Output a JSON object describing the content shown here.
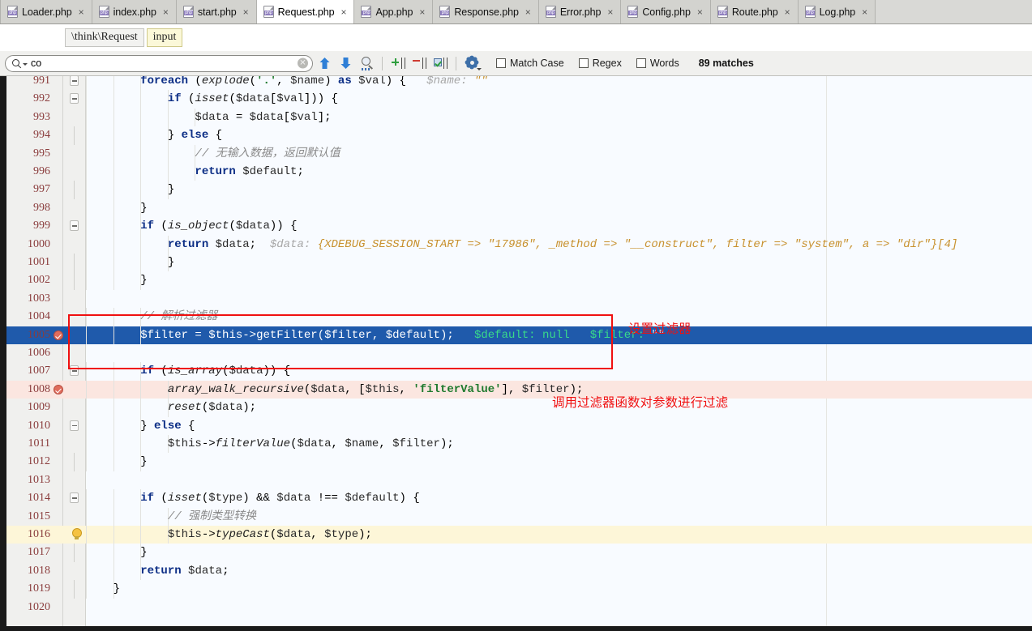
{
  "window": {
    "accent_selection": "#1f5aab",
    "annotation_color": "#f01010"
  },
  "tabs": [
    {
      "label": "Loader.php",
      "active": false,
      "close": "×",
      "icon": "php-file-icon"
    },
    {
      "label": "index.php",
      "active": false,
      "close": "×",
      "icon": "php-file-icon"
    },
    {
      "label": "start.php",
      "active": false,
      "close": "×",
      "icon": "php-file-icon"
    },
    {
      "label": "Request.php",
      "active": true,
      "close": "×",
      "icon": "php-file-icon"
    },
    {
      "label": "App.php",
      "active": false,
      "close": "×",
      "icon": "php-file-icon"
    },
    {
      "label": "Response.php",
      "active": false,
      "close": "×",
      "icon": "php-file-icon"
    },
    {
      "label": "Error.php",
      "active": false,
      "close": "×",
      "icon": "php-file-icon"
    },
    {
      "label": "Config.php",
      "active": false,
      "close": "×",
      "icon": "php-file-icon"
    },
    {
      "label": "Route.php",
      "active": false,
      "close": "×",
      "icon": "php-file-icon"
    },
    {
      "label": "Log.php",
      "active": false,
      "close": "×",
      "icon": "php-file-icon"
    }
  ],
  "breadcrumb": {
    "class": "\\think\\Request",
    "member": "input"
  },
  "search": {
    "query": "co",
    "clear_glyph": "✕",
    "match_case_label": "Match Case",
    "regex_label": "Regex",
    "words_label": "Words",
    "match_case_checked": false,
    "regex_checked": false,
    "words_checked": false,
    "result_count": "89 matches",
    "buttons": [
      {
        "name": "find-previous",
        "icon": "arrow-up-icon"
      },
      {
        "name": "find-next",
        "icon": "arrow-down-icon"
      },
      {
        "name": "find-all",
        "icon": "magnifier-list-icon"
      },
      {
        "name": "add-selection-next",
        "icon": "add-selection-icon"
      },
      {
        "name": "remove-selection",
        "icon": "remove-selection-icon"
      },
      {
        "name": "select-all-occurrences",
        "icon": "select-all-icon"
      },
      {
        "name": "search-settings",
        "icon": "gear-icon"
      }
    ]
  },
  "annotations": [
    {
      "id": "set-filter",
      "text": "设置过滤器"
    },
    {
      "id": "apply-filter",
      "text": "调用过滤器函数对参数进行过滤"
    }
  ],
  "editor": {
    "first_visible_line": 991,
    "lines": [
      {
        "n": 991,
        "fold": "collapse",
        "indent": 3,
        "state": "",
        "segments": [
          {
            "t": "        ",
            "c": "pm"
          },
          {
            "t": "foreach",
            "c": "kw"
          },
          {
            "t": " (",
            "c": "pm"
          },
          {
            "t": "explode",
            "c": "fn"
          },
          {
            "t": "(",
            "c": "pm"
          },
          {
            "t": "'.'",
            "c": "str"
          },
          {
            "t": ", ",
            "c": "pm"
          },
          {
            "t": "$name",
            "c": "var"
          },
          {
            "t": ") ",
            "c": "pm"
          },
          {
            "t": "as",
            "c": "kw"
          },
          {
            "t": " ",
            "c": "pm"
          },
          {
            "t": "$val",
            "c": "var"
          },
          {
            "t": ") {",
            "c": "pm"
          },
          {
            "t": "   $name: ",
            "c": "hint"
          },
          {
            "t": "\"\"",
            "c": "hintv"
          }
        ]
      },
      {
        "n": 992,
        "fold": "collapse",
        "indent": 4,
        "state": "",
        "segments": [
          {
            "t": "            ",
            "c": "pm"
          },
          {
            "t": "if",
            "c": "kw"
          },
          {
            "t": " (",
            "c": "pm"
          },
          {
            "t": "isset",
            "c": "fn"
          },
          {
            "t": "(",
            "c": "pm"
          },
          {
            "t": "$data",
            "c": "var"
          },
          {
            "t": "[",
            "c": "pm"
          },
          {
            "t": "$val",
            "c": "var"
          },
          {
            "t": "])) {",
            "c": "pm"
          }
        ]
      },
      {
        "n": 993,
        "fold": "",
        "indent": 5,
        "state": "",
        "segments": [
          {
            "t": "                ",
            "c": "pm"
          },
          {
            "t": "$data",
            "c": "var"
          },
          {
            "t": " = ",
            "c": "pm"
          },
          {
            "t": "$data",
            "c": "var"
          },
          {
            "t": "[",
            "c": "pm"
          },
          {
            "t": "$val",
            "c": "var"
          },
          {
            "t": "];",
            "c": "pm"
          }
        ]
      },
      {
        "n": 994,
        "fold": "end",
        "indent": 4,
        "state": "",
        "segments": [
          {
            "t": "            } ",
            "c": "pm"
          },
          {
            "t": "else",
            "c": "kw"
          },
          {
            "t": " {",
            "c": "pm"
          }
        ]
      },
      {
        "n": 995,
        "fold": "",
        "indent": 5,
        "state": "",
        "segments": [
          {
            "t": "                ",
            "c": "pm"
          },
          {
            "t": "// 无输入数据，返回默认值",
            "c": "cmt"
          }
        ]
      },
      {
        "n": 996,
        "fold": "",
        "indent": 5,
        "state": "",
        "segments": [
          {
            "t": "                ",
            "c": "pm"
          },
          {
            "t": "return",
            "c": "kw"
          },
          {
            "t": " ",
            "c": "pm"
          },
          {
            "t": "$default",
            "c": "var"
          },
          {
            "t": ";",
            "c": "pm"
          }
        ]
      },
      {
        "n": 997,
        "fold": "end",
        "indent": 4,
        "state": "",
        "segments": [
          {
            "t": "            }",
            "c": "pm"
          }
        ]
      },
      {
        "n": 998,
        "fold": "",
        "indent": 3,
        "state": "",
        "segments": [
          {
            "t": "        }",
            "c": "pm"
          }
        ]
      },
      {
        "n": 999,
        "fold": "collapse",
        "indent": 3,
        "state": "",
        "segments": [
          {
            "t": "        ",
            "c": "pm"
          },
          {
            "t": "if",
            "c": "kw"
          },
          {
            "t": " (",
            "c": "pm"
          },
          {
            "t": "is_object",
            "c": "fn"
          },
          {
            "t": "(",
            "c": "pm"
          },
          {
            "t": "$data",
            "c": "var"
          },
          {
            "t": ")) {",
            "c": "pm"
          }
        ]
      },
      {
        "n": 1000,
        "fold": "",
        "indent": 4,
        "state": "",
        "segments": [
          {
            "t": "            ",
            "c": "pm"
          },
          {
            "t": "return",
            "c": "kw"
          },
          {
            "t": " ",
            "c": "pm"
          },
          {
            "t": "$data",
            "c": "var"
          },
          {
            "t": ";",
            "c": "pm"
          },
          {
            "t": "  $data: ",
            "c": "hint"
          },
          {
            "t": "{XDEBUG_SESSION_START => \"17986\", _method => \"__construct\", filter => \"system\", a => \"dir\"}[4]",
            "c": "hintv"
          }
        ]
      },
      {
        "n": 1001,
        "fold": "end",
        "indent": 4,
        "state": "",
        "segments": [
          {
            "t": "            }",
            "c": "pm"
          }
        ]
      },
      {
        "n": 1002,
        "fold": "end",
        "indent": 3,
        "state": "",
        "segments": [
          {
            "t": "        }",
            "c": "pm"
          }
        ]
      },
      {
        "n": 1003,
        "fold": "",
        "indent": 0,
        "state": "",
        "segments": []
      },
      {
        "n": 1004,
        "fold": "",
        "indent": 3,
        "state": "",
        "segments": [
          {
            "t": "        ",
            "c": "pm"
          },
          {
            "t": "// 解析过滤器",
            "c": "cmt"
          }
        ]
      },
      {
        "n": 1005,
        "fold": "",
        "indent": 3,
        "state": "selected",
        "breakpoint": true,
        "segments": [
          {
            "t": "        ",
            "c": "pm"
          },
          {
            "t": "$filter",
            "c": "pm"
          },
          {
            "t": " = ",
            "c": "pm"
          },
          {
            "t": "$this",
            "c": "pm"
          },
          {
            "t": "->",
            "c": "pm"
          },
          {
            "t": "getFilter",
            "c": "pm"
          },
          {
            "t": "(",
            "c": "pm"
          },
          {
            "t": "$filter",
            "c": "pm"
          },
          {
            "t": ", ",
            "c": "pm"
          },
          {
            "t": "$default",
            "c": "pm"
          },
          {
            "t": ");",
            "c": "pm"
          },
          {
            "t": "   $default: null   $filter: ",
            "c": "hintg"
          },
          {
            "t": "\"\"",
            "c": "hintq"
          }
        ]
      },
      {
        "n": 1006,
        "fold": "",
        "indent": 0,
        "state": "",
        "segments": []
      },
      {
        "n": 1007,
        "fold": "collapse",
        "indent": 3,
        "state": "",
        "segments": [
          {
            "t": "        ",
            "c": "pm"
          },
          {
            "t": "if",
            "c": "kw"
          },
          {
            "t": " (",
            "c": "pm"
          },
          {
            "t": "is_array",
            "c": "fn"
          },
          {
            "t": "(",
            "c": "pm"
          },
          {
            "t": "$data",
            "c": "var"
          },
          {
            "t": ")) {",
            "c": "pm"
          }
        ]
      },
      {
        "n": 1008,
        "fold": "",
        "indent": 4,
        "state": "breakpoint-line",
        "breakpoint": true,
        "segments": [
          {
            "t": "            ",
            "c": "pm"
          },
          {
            "t": "array_walk_recursive",
            "c": "fn"
          },
          {
            "t": "(",
            "c": "pm"
          },
          {
            "t": "$data",
            "c": "var"
          },
          {
            "t": ", [",
            "c": "pm"
          },
          {
            "t": "$this",
            "c": "var"
          },
          {
            "t": ", ",
            "c": "pm"
          },
          {
            "t": "'filterValue'",
            "c": "str"
          },
          {
            "t": "], ",
            "c": "pm"
          },
          {
            "t": "$filter",
            "c": "var"
          },
          {
            "t": ");",
            "c": "pm"
          }
        ]
      },
      {
        "n": 1009,
        "fold": "",
        "indent": 4,
        "state": "",
        "segments": [
          {
            "t": "            ",
            "c": "pm"
          },
          {
            "t": "reset",
            "c": "fn"
          },
          {
            "t": "(",
            "c": "pm"
          },
          {
            "t": "$data",
            "c": "var"
          },
          {
            "t": ");",
            "c": "pm"
          }
        ]
      },
      {
        "n": 1010,
        "fold": "collapse",
        "indent": 3,
        "state": "",
        "segments": [
          {
            "t": "        } ",
            "c": "pm"
          },
          {
            "t": "else",
            "c": "kw"
          },
          {
            "t": " {",
            "c": "pm"
          }
        ]
      },
      {
        "n": 1011,
        "fold": "",
        "indent": 4,
        "state": "",
        "segments": [
          {
            "t": "            ",
            "c": "pm"
          },
          {
            "t": "$this",
            "c": "var"
          },
          {
            "t": "->",
            "c": "pm"
          },
          {
            "t": "filterValue",
            "c": "fn"
          },
          {
            "t": "(",
            "c": "pm"
          },
          {
            "t": "$data",
            "c": "var"
          },
          {
            "t": ", ",
            "c": "pm"
          },
          {
            "t": "$name",
            "c": "var"
          },
          {
            "t": ", ",
            "c": "pm"
          },
          {
            "t": "$filter",
            "c": "var"
          },
          {
            "t": ");",
            "c": "pm"
          }
        ]
      },
      {
        "n": 1012,
        "fold": "end",
        "indent": 3,
        "state": "",
        "segments": [
          {
            "t": "        }",
            "c": "pm"
          }
        ]
      },
      {
        "n": 1013,
        "fold": "",
        "indent": 0,
        "state": "",
        "segments": []
      },
      {
        "n": 1014,
        "fold": "collapse",
        "indent": 3,
        "state": "",
        "segments": [
          {
            "t": "        ",
            "c": "pm"
          },
          {
            "t": "if",
            "c": "kw"
          },
          {
            "t": " (",
            "c": "pm"
          },
          {
            "t": "isset",
            "c": "fn"
          },
          {
            "t": "(",
            "c": "pm"
          },
          {
            "t": "$type",
            "c": "var"
          },
          {
            "t": ") && ",
            "c": "pm"
          },
          {
            "t": "$data",
            "c": "var"
          },
          {
            "t": " !== ",
            "c": "pm"
          },
          {
            "t": "$default",
            "c": "var"
          },
          {
            "t": ") {",
            "c": "pm"
          }
        ]
      },
      {
        "n": 1015,
        "fold": "",
        "indent": 4,
        "state": "",
        "segments": [
          {
            "t": "            ",
            "c": "pm"
          },
          {
            "t": "// 强制类型转换",
            "c": "cmt"
          }
        ]
      },
      {
        "n": 1016,
        "fold": "",
        "indent": 4,
        "state": "intention",
        "bulb": true,
        "segments": [
          {
            "t": "            ",
            "c": "pm"
          },
          {
            "t": "$this",
            "c": "var"
          },
          {
            "t": "->",
            "c": "pm"
          },
          {
            "t": "typeCast",
            "c": "fn"
          },
          {
            "t": "(",
            "c": "pm"
          },
          {
            "t": "$data",
            "c": "var"
          },
          {
            "t": ", ",
            "c": "pm"
          },
          {
            "t": "$type",
            "c": "var"
          },
          {
            "t": ");",
            "c": "pm"
          }
        ]
      },
      {
        "n": 1017,
        "fold": "end",
        "indent": 3,
        "state": "",
        "segments": [
          {
            "t": "        }",
            "c": "pm"
          }
        ]
      },
      {
        "n": 1018,
        "fold": "",
        "indent": 3,
        "state": "",
        "segments": [
          {
            "t": "        ",
            "c": "pm"
          },
          {
            "t": "return",
            "c": "kw"
          },
          {
            "t": " ",
            "c": "pm"
          },
          {
            "t": "$data",
            "c": "var"
          },
          {
            "t": ";",
            "c": "pm"
          }
        ]
      },
      {
        "n": 1019,
        "fold": "end",
        "indent": 2,
        "state": "",
        "segments": [
          {
            "t": "    }",
            "c": "pm"
          }
        ]
      },
      {
        "n": 1020,
        "fold": "",
        "indent": 0,
        "state": "",
        "segments": []
      }
    ]
  }
}
